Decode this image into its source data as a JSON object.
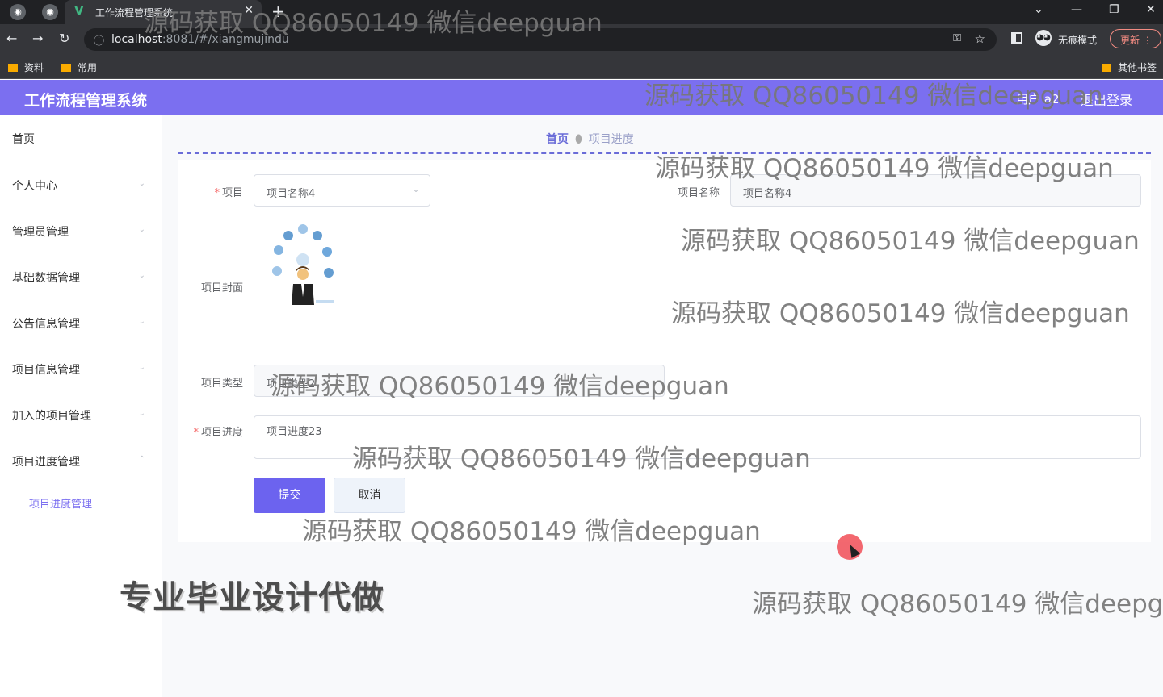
{
  "browser": {
    "tab_title": "工作流程管理系统",
    "url_host": "localhost",
    "url_path": ":8081/#/xiangmujindu",
    "incognito_label": "无痕模式",
    "update_label": "更新",
    "bookmarks": [
      "资料",
      "常用"
    ],
    "other_bookmarks": "其他书签"
  },
  "header": {
    "app_title": "工作流程管理系统",
    "user_label": "用户 a2",
    "logout_label": "退出登录"
  },
  "sidebar": {
    "items": [
      {
        "label": "首页"
      },
      {
        "label": "个人中心"
      },
      {
        "label": "管理员管理"
      },
      {
        "label": "基础数据管理"
      },
      {
        "label": "公告信息管理"
      },
      {
        "label": "项目信息管理"
      },
      {
        "label": "加入的项目管理"
      },
      {
        "label": "项目进度管理"
      }
    ],
    "sub_item": "项目进度管理"
  },
  "breadcrumb": {
    "home": "首页",
    "current": "项目进度"
  },
  "form": {
    "project_label": "项目",
    "project_value": "项目名称4",
    "name_label": "项目名称",
    "name_value": "项目名称4",
    "cover_label": "项目封面",
    "type_label": "项目类型",
    "type_value": "项目类型2",
    "progress_label": "项目进度",
    "progress_value": "项目进度23",
    "submit_label": "提交",
    "cancel_label": "取消"
  },
  "overlay": {
    "watermark": "源码获取 QQ86050149 微信deepguan",
    "promo": "专业毕业设计代做"
  }
}
